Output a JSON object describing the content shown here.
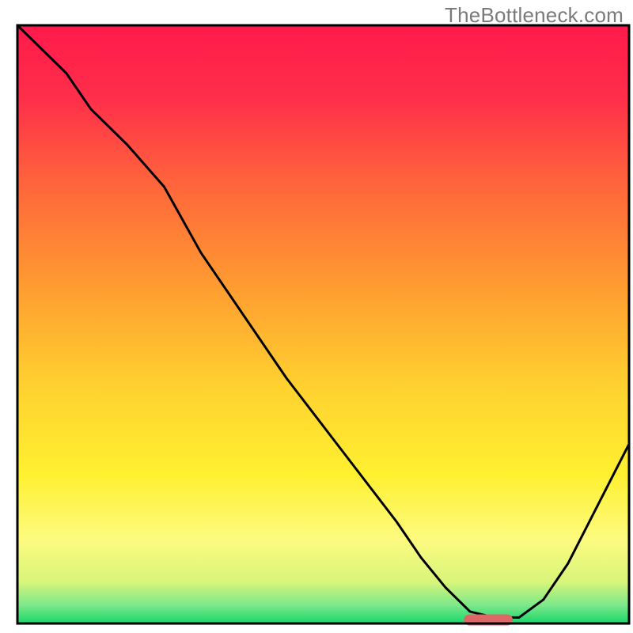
{
  "watermark": "TheBottleneck.com",
  "chart_data": {
    "type": "line",
    "title": "",
    "xlabel": "",
    "ylabel": "",
    "xlim": [
      0,
      100
    ],
    "ylim": [
      0,
      100
    ],
    "grid": false,
    "legend_position": "none",
    "annotations": [],
    "series": [
      {
        "name": "bottleneck-curve",
        "x": [
          0,
          8,
          12,
          18,
          24,
          30,
          38,
          44,
          50,
          56,
          62,
          66,
          70,
          74,
          78,
          82,
          86,
          90,
          94,
          100
        ],
        "y": [
          100,
          92,
          86,
          80,
          73,
          62,
          50,
          41,
          33,
          25,
          17,
          11,
          6,
          2,
          1,
          1,
          4,
          10,
          18,
          30
        ]
      }
    ],
    "marker": {
      "name": "optimal-zone",
      "x_center": 77,
      "y": 0.6,
      "width": 8,
      "color": "#e06666"
    },
    "background_gradient": {
      "stops": [
        {
          "offset": 0.0,
          "color": "#ff1a4b"
        },
        {
          "offset": 0.12,
          "color": "#ff2e4a"
        },
        {
          "offset": 0.28,
          "color": "#ff6a3a"
        },
        {
          "offset": 0.45,
          "color": "#ffa030"
        },
        {
          "offset": 0.6,
          "color": "#ffd030"
        },
        {
          "offset": 0.75,
          "color": "#fff030"
        },
        {
          "offset": 0.86,
          "color": "#fdfb80"
        },
        {
          "offset": 0.93,
          "color": "#d8f57a"
        },
        {
          "offset": 0.97,
          "color": "#7be88a"
        },
        {
          "offset": 1.0,
          "color": "#17d66a"
        }
      ]
    },
    "border_color": "#000000",
    "border_width": 3
  }
}
